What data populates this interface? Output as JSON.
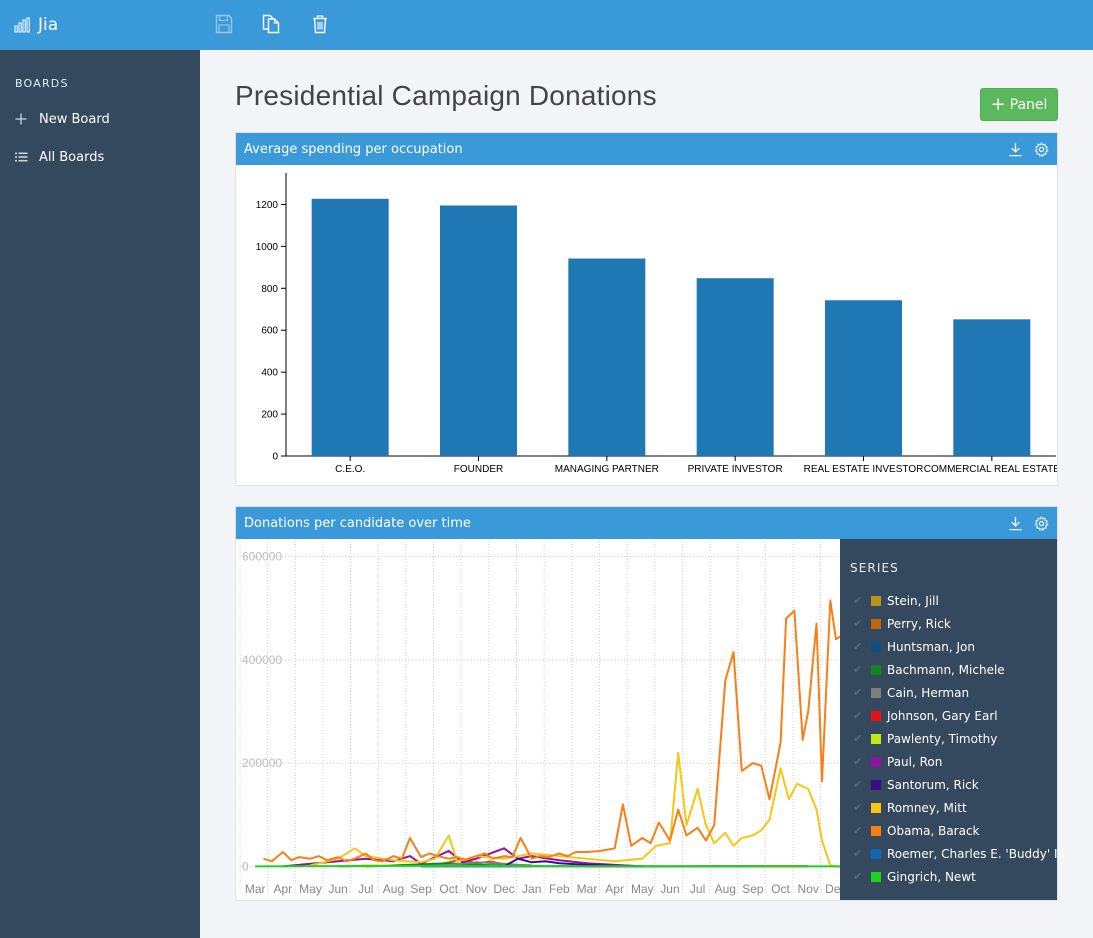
{
  "app": {
    "name": "Jia"
  },
  "toolbar": {
    "save_icon": "save-icon",
    "copy_icon": "copy-icon",
    "delete_icon": "trash-icon"
  },
  "sidebar": {
    "heading": "BOARDS",
    "items": [
      {
        "label": "New Board",
        "icon": "plus-icon"
      },
      {
        "label": "All Boards",
        "icon": "list-icon"
      }
    ]
  },
  "board": {
    "title": "Presidential Campaign Donations",
    "add_panel_label": "Panel"
  },
  "colors": {
    "topbar": "#3a9ad9",
    "sidebar": "#34495e",
    "bar": "#1f77b4",
    "add_button": "#5cb85c"
  },
  "panels": [
    {
      "title": "Average spending per occupation"
    },
    {
      "title": "Donations per candidate over time",
      "legend_title": "SERIES"
    }
  ],
  "chart_data": [
    {
      "type": "bar",
      "title": "Average spending per occupation",
      "categories": [
        "C.E.O.",
        "FOUNDER",
        "MANAGING PARTNER",
        "PRIVATE INVESTOR",
        "REAL ESTATE INVESTOR",
        "COMMERCIAL REAL ESTATE"
      ],
      "values": [
        1227,
        1195,
        942,
        848,
        743,
        652
      ],
      "yticks": [
        "0",
        "200",
        "400",
        "600",
        "800",
        "1000",
        "1200"
      ],
      "ylim": [
        0,
        1350
      ],
      "color": "#1f77b4"
    },
    {
      "type": "line",
      "title": "Donations per candidate over time",
      "x_labels": [
        "Mar",
        "Apr",
        "May",
        "Jun",
        "Jul",
        "Aug",
        "Sep",
        "Oct",
        "Nov",
        "Dec",
        "Jan",
        "Feb",
        "Mar",
        "Apr",
        "May",
        "Jun",
        "Jul",
        "Aug",
        "Sep",
        "Oct",
        "Nov",
        "Dec"
      ],
      "yticks": [
        "0",
        "200000",
        "400000",
        "600000"
      ],
      "ylim": [
        -5000,
        630000
      ],
      "legend_position": "right",
      "series": [
        {
          "name": "Stein, Jill",
          "color": "#b8951c",
          "points": [
            [
              16,
              200
            ],
            [
              19,
              500
            ],
            [
              20,
              300
            ]
          ]
        },
        {
          "name": "Perry, Rick",
          "color": "#c2620e",
          "points": [
            [
              6.3,
              0
            ],
            [
              7,
              8000
            ],
            [
              7.5,
              15000
            ],
            [
              8,
              5000
            ],
            [
              8.5,
              10000
            ],
            [
              9,
              4000
            ],
            [
              10,
              2000
            ]
          ]
        },
        {
          "name": "Huntsman, Jon",
          "color": "#0a4f8a",
          "points": [
            [
              3,
              0
            ],
            [
              5,
              2000
            ],
            [
              7,
              3000
            ],
            [
              9,
              1000
            ],
            [
              10,
              500
            ]
          ]
        },
        {
          "name": "Bachmann, Michele",
          "color": "#14831d",
          "points": [
            [
              4,
              0
            ],
            [
              6,
              4000
            ],
            [
              7,
              6000
            ],
            [
              8,
              3000
            ],
            [
              10,
              1000
            ]
          ]
        },
        {
          "name": "Cain, Herman",
          "color": "#7f7f7f",
          "points": [
            [
              6,
              0
            ],
            [
              7,
              3000
            ],
            [
              8,
              8000
            ],
            [
              9,
              5000
            ],
            [
              10,
              1000
            ]
          ]
        },
        {
          "name": "Johnson, Gary Earl",
          "color": "#e8101b",
          "points": [
            [
              12,
              0
            ],
            [
              18,
              300
            ],
            [
              20,
              500
            ]
          ]
        },
        {
          "name": "Pawlenty, Timothy",
          "color": "#c0ea18",
          "points": [
            [
              3,
              0
            ],
            [
              4,
              2000
            ],
            [
              5,
              1500
            ],
            [
              5.5,
              0
            ]
          ]
        },
        {
          "name": "Paul, Ron",
          "color": "#8e14a2",
          "points": [
            [
              1,
              0
            ],
            [
              2,
              5000
            ],
            [
              3,
              10000
            ],
            [
              4,
              15000
            ],
            [
              5,
              10000
            ],
            [
              5.6,
              20000
            ],
            [
              6,
              5000
            ],
            [
              7,
              30000
            ],
            [
              7.5,
              8000
            ],
            [
              8,
              15000
            ],
            [
              9,
              35000
            ],
            [
              9.5,
              15000
            ],
            [
              10,
              20000
            ],
            [
              11,
              12000
            ],
            [
              12,
              6000
            ],
            [
              13,
              3000
            ],
            [
              14,
              0
            ]
          ]
        },
        {
          "name": "Santorum, Rick",
          "color": "#3b0c83",
          "points": [
            [
              9,
              0
            ],
            [
              9.5,
              15000
            ],
            [
              10,
              8000
            ],
            [
              10.5,
              10000
            ],
            [
              11,
              6000
            ],
            [
              12,
              3000
            ],
            [
              13,
              1000
            ],
            [
              14,
              0
            ]
          ]
        },
        {
          "name": "Romney, Mitt",
          "color": "#f8c513",
          "points": [
            [
              2,
              2000
            ],
            [
              3,
              15000
            ],
            [
              3.6,
              35000
            ],
            [
              4,
              20000
            ],
            [
              5,
              12000
            ],
            [
              6,
              8000
            ],
            [
              6.5,
              15000
            ],
            [
              7,
              60000
            ],
            [
              7.3,
              10000
            ],
            [
              8,
              20000
            ],
            [
              9,
              15000
            ],
            [
              10,
              25000
            ],
            [
              11,
              20000
            ],
            [
              12,
              15000
            ],
            [
              13,
              10000
            ],
            [
              14,
              15000
            ],
            [
              14.5,
              40000
            ],
            [
              15,
              45000
            ],
            [
              15.3,
              220000
            ],
            [
              15.6,
              80000
            ],
            [
              16,
              150000
            ],
            [
              16.3,
              80000
            ],
            [
              16.6,
              45000
            ],
            [
              17,
              65000
            ],
            [
              17.3,
              40000
            ],
            [
              17.6,
              55000
            ],
            [
              18,
              60000
            ],
            [
              18.3,
              70000
            ],
            [
              18.6,
              90000
            ],
            [
              19,
              190000
            ],
            [
              19.3,
              130000
            ],
            [
              19.6,
              160000
            ],
            [
              20,
              150000
            ],
            [
              20.3,
              110000
            ],
            [
              20.5,
              50000
            ],
            [
              20.8,
              2000
            ],
            [
              21,
              0
            ],
            [
              22,
              0
            ]
          ]
        },
        {
          "name": "Obama, Barack",
          "color": "#f77f15",
          "points": [
            [
              0.3,
              15000
            ],
            [
              0.6,
              10000
            ],
            [
              1,
              28000
            ],
            [
              1.3,
              12000
            ],
            [
              1.6,
              18000
            ],
            [
              2,
              15000
            ],
            [
              2.3,
              20000
            ],
            [
              2.6,
              12000
            ],
            [
              3,
              18000
            ],
            [
              3.3,
              10000
            ],
            [
              3.6,
              15000
            ],
            [
              4,
              25000
            ],
            [
              4.3,
              12000
            ],
            [
              4.6,
              10000
            ],
            [
              5,
              20000
            ],
            [
              5.3,
              15000
            ],
            [
              5.6,
              55000
            ],
            [
              6,
              18000
            ],
            [
              6.3,
              25000
            ],
            [
              6.6,
              20000
            ],
            [
              7,
              15000
            ],
            [
              7.3,
              18000
            ],
            [
              7.6,
              12000
            ],
            [
              8,
              20000
            ],
            [
              8.3,
              25000
            ],
            [
              8.6,
              15000
            ],
            [
              9,
              20000
            ],
            [
              9.3,
              18000
            ],
            [
              9.6,
              55000
            ],
            [
              10,
              15000
            ],
            [
              10.3,
              20000
            ],
            [
              10.6,
              18000
            ],
            [
              11,
              25000
            ],
            [
              11.3,
              20000
            ],
            [
              11.6,
              28000
            ],
            [
              12,
              28000
            ],
            [
              12.5,
              30000
            ],
            [
              13,
              35000
            ],
            [
              13.3,
              120000
            ],
            [
              13.6,
              40000
            ],
            [
              14,
              55000
            ],
            [
              14.3,
              45000
            ],
            [
              14.6,
              85000
            ],
            [
              15,
              50000
            ],
            [
              15.3,
              110000
            ],
            [
              15.6,
              60000
            ],
            [
              16,
              75000
            ],
            [
              16.3,
              50000
            ],
            [
              16.6,
              80000
            ],
            [
              17,
              360000
            ],
            [
              17.3,
              415000
            ],
            [
              17.6,
              185000
            ],
            [
              18,
              200000
            ],
            [
              18.3,
              195000
            ],
            [
              18.6,
              130000
            ],
            [
              19,
              240000
            ],
            [
              19.2,
              480000
            ],
            [
              19.5,
              495000
            ],
            [
              19.8,
              245000
            ],
            [
              20,
              300000
            ],
            [
              20.3,
              470000
            ],
            [
              20.5,
              165000
            ],
            [
              20.8,
              515000
            ],
            [
              21,
              440000
            ],
            [
              21.3,
              450000
            ],
            [
              21.6,
              20000
            ],
            [
              21.8,
              5000
            ],
            [
              22,
              0
            ]
          ]
        },
        {
          "name": "Roemer, Charles E. 'Buddy' III",
          "color": "#0a68b8",
          "points": [
            [
              6,
              0
            ],
            [
              10,
              200
            ],
            [
              14,
              100
            ],
            [
              18,
              0
            ]
          ]
        },
        {
          "name": "Gingrich, Newt",
          "color": "#1fd21f",
          "points": [
            [
              0,
              0
            ],
            [
              5,
              1000
            ],
            [
              9,
              1000
            ],
            [
              12,
              500
            ],
            [
              16,
              0
            ],
            [
              21.5,
              0
            ]
          ]
        }
      ]
    }
  ]
}
